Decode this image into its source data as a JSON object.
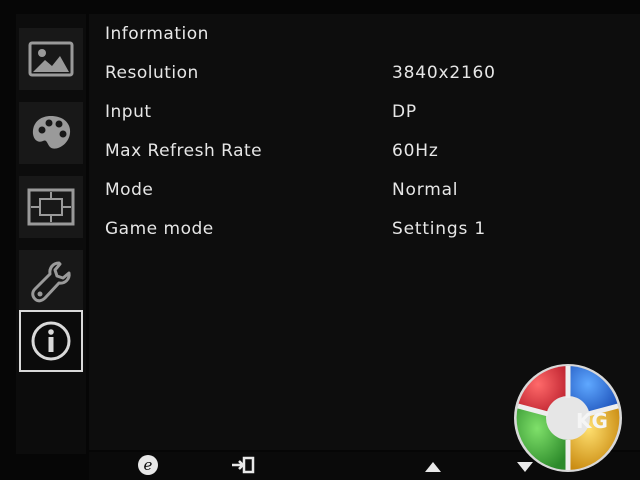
{
  "sidebar": {
    "items": [
      {
        "icon": "picture-icon"
      },
      {
        "icon": "palette-icon"
      },
      {
        "icon": "display-size-icon"
      },
      {
        "icon": "wrench-icon"
      },
      {
        "icon": "info-icon",
        "active": true
      }
    ]
  },
  "panel": {
    "title": "Information",
    "rows": [
      {
        "label": "Resolution",
        "value": "3840x2160"
      },
      {
        "label": "Input",
        "value": "DP"
      },
      {
        "label": "Max Refresh Rate",
        "value": "60Hz"
      },
      {
        "label": "Mode",
        "value": "Normal"
      },
      {
        "label": "Game mode",
        "value": "Settings 1"
      }
    ]
  },
  "bottombar": {
    "icons": [
      "e-key-icon",
      "exit-icon",
      "up-arrow-icon",
      "down-arrow-icon"
    ]
  },
  "watermark": {
    "text": "KG"
  },
  "colors": {
    "text": "#e6e6e6",
    "panel_bg": "#0d0d0d",
    "active_border": "#d9d9d9"
  }
}
